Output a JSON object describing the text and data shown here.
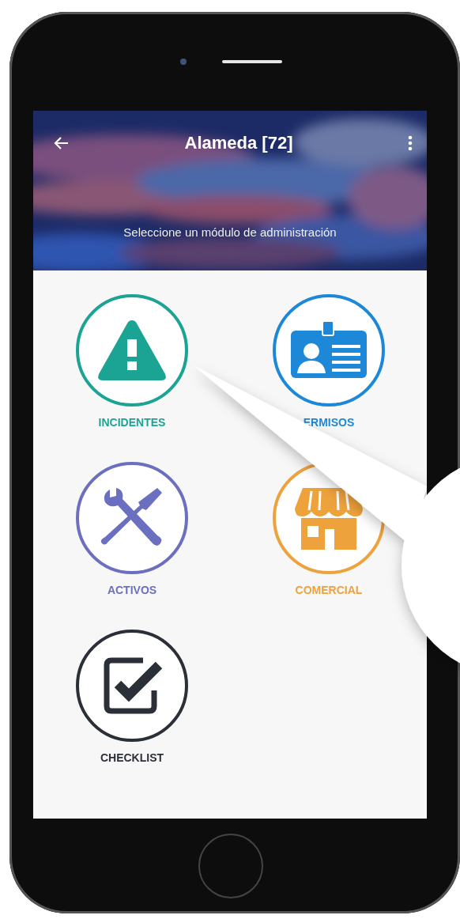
{
  "app_bar": {
    "title": "Alameda [72]",
    "subtitle": "Seleccione un módulo de administración"
  },
  "modules": [
    {
      "label": "INCIDENTES",
      "kind": "warning",
      "color": "#1ba394"
    },
    {
      "label": "ERMISOS",
      "kind": "badge",
      "color": "#1e88d8"
    },
    {
      "label": "ACTIVOS",
      "kind": "tools",
      "color": "#6b6fbf"
    },
    {
      "label": "COMERCIAL",
      "kind": "shop",
      "color": "#eea23c"
    },
    {
      "label": "CHECKLIST",
      "kind": "check",
      "color": "#2b3038"
    }
  ]
}
